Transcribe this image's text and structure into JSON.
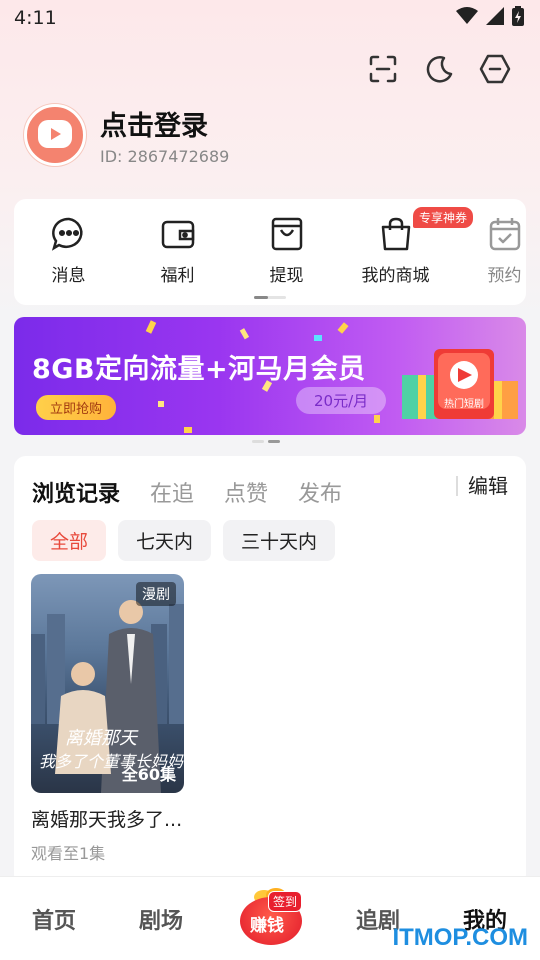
{
  "status_bar": {
    "time": "4:11"
  },
  "profile": {
    "login_text": "点击登录",
    "user_id": "ID: 2867472689"
  },
  "top_actions": [
    {
      "icon": "scan-icon"
    },
    {
      "icon": "moon-icon"
    },
    {
      "icon": "settings-hexagon-icon"
    }
  ],
  "shortcuts": [
    {
      "label": "消息",
      "icon": "message-icon"
    },
    {
      "label": "福利",
      "icon": "wallet-icon"
    },
    {
      "label": "提现",
      "icon": "withdraw-icon"
    },
    {
      "label": "我的商城",
      "icon": "shopping-bag-icon",
      "badge": "专享神券"
    },
    {
      "label": "预约",
      "icon": "calendar-icon"
    }
  ],
  "banner": {
    "title": "8GB定向流量+河马月会员",
    "button": "立即抢购",
    "price": "20元/月",
    "gift_label": "热门短剧"
  },
  "history": {
    "tabs": [
      "浏览记录",
      "在追",
      "点赞",
      "发布"
    ],
    "active_tab": 0,
    "edit_label": "编辑",
    "filters": [
      "全部",
      "七天内",
      "三十天内"
    ],
    "active_filter": 0,
    "items": [
      {
        "tag": "漫剧",
        "episodes": "全60集",
        "poster_line1": "离婚那天",
        "poster_line2": "我多了个董事长妈妈",
        "title": "离婚那天我多了...",
        "progress": "观看至1集"
      }
    ]
  },
  "bottom_nav": {
    "items": [
      "首页",
      "剧场",
      "追剧",
      "我的"
    ],
    "active": 3,
    "earn_label": "赚钱",
    "earn_badge": "签到"
  },
  "watermark": "ITMOP.COM",
  "colors": {
    "accent": "#e84a3c",
    "badge": "#ef4b46",
    "watermark": "#1e8ee0"
  }
}
